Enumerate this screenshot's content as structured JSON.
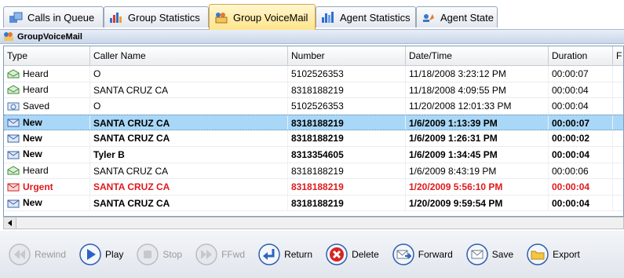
{
  "tabs": [
    {
      "label": "Calls in Queue",
      "icon": "calls-queue-icon"
    },
    {
      "label": "Group Statistics",
      "icon": "bar-chart-icon"
    },
    {
      "label": "Group VoiceMail",
      "icon": "group-voicemail-icon",
      "active": true
    },
    {
      "label": "Agent Statistics",
      "icon": "agent-chart-icon"
    },
    {
      "label": "Agent State",
      "icon": "agent-state-icon"
    }
  ],
  "panel": {
    "title": "GroupVoiceMail"
  },
  "grid": {
    "columns": [
      "Type",
      "Caller Name",
      "Number",
      "Date/Time",
      "Duration",
      "F"
    ],
    "rows": [
      {
        "type": "Heard",
        "name": "O",
        "number": "5102526353",
        "datetime": "11/18/2008 3:23:12 PM",
        "duration": "00:00:07"
      },
      {
        "type": "Heard",
        "name": "SANTA CRUZ  CA",
        "number": "8318188219",
        "datetime": "11/18/2008 4:09:55 PM",
        "duration": "00:00:04"
      },
      {
        "type": "Saved",
        "name": "O",
        "number": "5102526353",
        "datetime": "11/20/2008 12:01:33 PM",
        "duration": "00:00:04"
      },
      {
        "type": "New",
        "name": "SANTA CRUZ  CA",
        "number": "8318188219",
        "datetime": "1/6/2009 1:13:39 PM",
        "duration": "00:00:07"
      },
      {
        "type": "New",
        "name": "SANTA CRUZ  CA",
        "number": "8318188219",
        "datetime": "1/6/2009 1:26:31 PM",
        "duration": "00:00:02"
      },
      {
        "type": "New",
        "name": "Tyler B",
        "number": "8313354605",
        "datetime": "1/6/2009 1:34:45 PM",
        "duration": "00:00:04"
      },
      {
        "type": "Heard",
        "name": "SANTA CRUZ  CA",
        "number": "8318188219",
        "datetime": "1/6/2009 8:43:19 PM",
        "duration": "00:00:06"
      },
      {
        "type": "Urgent",
        "name": "SANTA CRUZ  CA",
        "number": "8318188219",
        "datetime": "1/20/2009 5:56:10 PM",
        "duration": "00:00:04"
      },
      {
        "type": "New",
        "name": "SANTA CRUZ  CA",
        "number": "8318188219",
        "datetime": "1/20/2009 9:59:54 PM",
        "duration": "00:00:04"
      }
    ]
  },
  "toolbar": {
    "rewind": "Rewind",
    "play": "Play",
    "stop": "Stop",
    "ffwd": "FFwd",
    "return": "Return",
    "delete": "Delete",
    "forward": "Forward",
    "save": "Save",
    "export": "Export"
  },
  "colors": {
    "selected_row": "#a9d7f7",
    "urgent": "#e0191d",
    "active_tab": "#ffe48a"
  }
}
